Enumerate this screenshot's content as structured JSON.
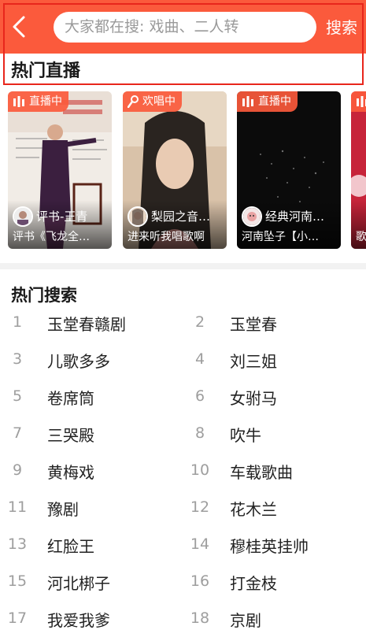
{
  "header": {
    "search_placeholder": "大家都在搜: 戏曲、二人转",
    "search_button": "搜索"
  },
  "live_section": {
    "title": "热门直播",
    "cards": [
      {
        "badge": "直播中",
        "badge_icon": "live-bars-icon",
        "host": "评书-王青",
        "desc": "评书《飞龙全…"
      },
      {
        "badge": "欢唱中",
        "badge_icon": "microphone-icon",
        "host": "梨园之音…",
        "desc": "进来听我唱歌啊"
      },
      {
        "badge": "直播中",
        "badge_icon": "live-bars-icon",
        "host": "经典河南…",
        "desc": "河南坠子【小…"
      },
      {
        "badge": "",
        "badge_icon": "live-bars-icon",
        "host": "",
        "desc": "歌"
      }
    ]
  },
  "hot_search": {
    "title": "热门搜索",
    "items": [
      {
        "rank": "1",
        "term": "玉堂春赣剧"
      },
      {
        "rank": "2",
        "term": "玉堂春"
      },
      {
        "rank": "3",
        "term": "儿歌多多"
      },
      {
        "rank": "4",
        "term": "刘三姐"
      },
      {
        "rank": "5",
        "term": "卷席筒"
      },
      {
        "rank": "6",
        "term": "女驸马"
      },
      {
        "rank": "7",
        "term": "三哭殿"
      },
      {
        "rank": "8",
        "term": "吹牛"
      },
      {
        "rank": "9",
        "term": "黄梅戏"
      },
      {
        "rank": "10",
        "term": "车载歌曲"
      },
      {
        "rank": "11",
        "term": "豫剧"
      },
      {
        "rank": "12",
        "term": "花木兰"
      },
      {
        "rank": "13",
        "term": "红脸王"
      },
      {
        "rank": "14",
        "term": "穆桂英挂帅"
      },
      {
        "rank": "15",
        "term": "河北梆子"
      },
      {
        "rank": "16",
        "term": "打金枝"
      },
      {
        "rank": "17",
        "term": "我爱我爹"
      },
      {
        "rank": "18",
        "term": "京剧"
      }
    ]
  },
  "colors": {
    "accent": "#fb5a3c",
    "highlight_frame": "#e8261c",
    "rank_text": "#9e9e9e"
  }
}
